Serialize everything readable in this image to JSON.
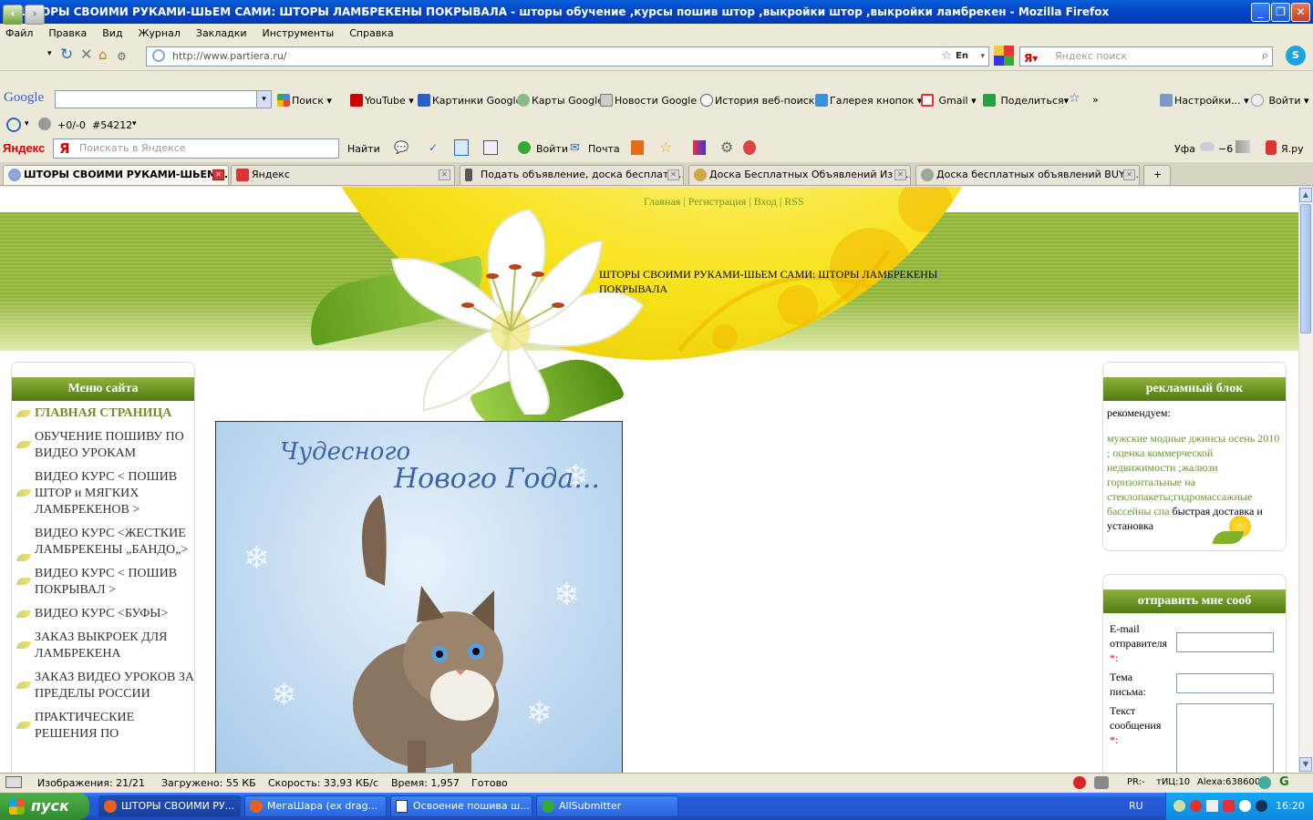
{
  "window": {
    "title": "ШТОРЫ СВОИМИ РУКАМИ-ШЬЕМ САМИ: ШТОРЫ ЛАМБРЕКЕНЫ ПОКРЫВАЛА - шторы обучение ,курсы пошив штор ,выкройки штор ,выкройки ламбрекен - Mozilla Firefox"
  },
  "menu": [
    "Файл",
    "Правка",
    "Вид",
    "Журнал",
    "Закладки",
    "Инструменты",
    "Справка"
  ],
  "nav": {
    "url": "http://www.partiera.ru/",
    "lang_badge": "En",
    "search_placeholder": "Яндекс поиск"
  },
  "google_toolbar": {
    "logo": "Google",
    "items": [
      "Поиск",
      "YouTube",
      "Картинки Google",
      "Карты Google",
      "Новости Google",
      "История веб-поиска",
      "Галерея кнопок",
      "Gmail",
      "Поделиться",
      "»",
      "Настройки...",
      "Войти"
    ]
  },
  "misc_toolbar": {
    "counter": "+0/-0",
    "id": "#54212"
  },
  "yandex_toolbar": {
    "logo": "Яндекс",
    "placeholder": "Поискать в Яндексе",
    "find": "Найти",
    "login": "Войти",
    "mail": "Почта",
    "city": "Уфа",
    "temp": "−6",
    "yaru": "Я.ру"
  },
  "tabs": [
    {
      "label": "ШТОРЫ СВОИМИ РУКАМИ-ШЬЕМ ...",
      "active": true
    },
    {
      "label": "Яндекс",
      "active": false
    },
    {
      "label": "Подать объявление, доска бесплатн...",
      "active": false
    },
    {
      "label": "Доска Бесплатных Объявлений Из р...",
      "active": false
    },
    {
      "label": "Доска бесплатных объявлений BUY. ...",
      "active": false
    }
  ],
  "page": {
    "nav_links": [
      "Главная",
      "Регистрация",
      "Вход",
      "RSS"
    ],
    "site_title": "ШТОРЫ СВОИМИ РУКАМИ-ШЬЕМ САМИ: ШТОРЫ ЛАМБРЕКЕНЫ ПОКРЫВАЛА",
    "menu_title": "Меню сайта",
    "menu_items": [
      "ГЛАВНАЯ СТРАНИЦА",
      "ОБУЧЕНИЕ ПОШИВУ ПО ВИДЕО УРОКАМ",
      "ВИДЕО КУРС < ПОШИВ ШТОР и МЯГКИХ ЛАМБРЕКЕНОВ >",
      "ВИДЕО КУРС <ЖЕСТКИЕ ЛАМБРЕКЕНЫ „БАНДО„>",
      "ВИДЕО КУРС < ПОШИВ ПОКРЫВАЛ >",
      "ВИДЕО КУРС <БУФЫ>",
      "ЗАКАЗ ВЫКРОЕК ДЛЯ ЛАМБРЕКЕНА",
      "ЗАКАЗ ВИДЕО УРОКОВ ЗА ПРЕДЕЛЫ РОССИИ",
      "ПРАКТИЧЕСКИЕ РЕШЕНИЯ ПО"
    ],
    "card_line1": "Чудесного",
    "card_line2": "Нового Года...",
    "ad_title": "рекламный блок",
    "ad_recommend": "рекомендуем:",
    "ad_link1": "мужские модные джинсы осень 2010",
    "ad_sep1": " ; ",
    "ad_link2": "оценка коммерческой недвижимости",
    "ad_sep2": " ;",
    "ad_link3": "жалюзи горизонтальные на стеклопакеты",
    "ad_sep3": ";",
    "ad_link4": "гидромассажные бассейны спа",
    "ad_tail": " быстрая доставка и установка",
    "form_title": "отправить мне сооб",
    "form_email": "E-mail отправителя",
    "form_subject": "Тема письма:",
    "form_message": "Текст сообщения",
    "req_mark": "*:"
  },
  "status": {
    "images": "Изображения: 21/21",
    "loaded": "Загружено: 55 КБ",
    "speed": "Скорость: 33,93 КБ/с",
    "time": "Время: 1,957",
    "state": "Готово",
    "pr": "PR:-",
    "tic": "тИЦ:10",
    "alexa": "Alexa:638600"
  },
  "taskbar": {
    "start": "пуск",
    "tasks": [
      "ШТОРЫ СВОИМИ РУ...",
      "МегаШара (ex drag...",
      "Освоение пошива ш...",
      "AllSubmitter"
    ],
    "lang": "RU",
    "clock": "16:20"
  },
  "colors": {
    "accent_green": "#8fb23a",
    "link_green": "#6a9a2a",
    "xp_blue": "#245ddb"
  }
}
